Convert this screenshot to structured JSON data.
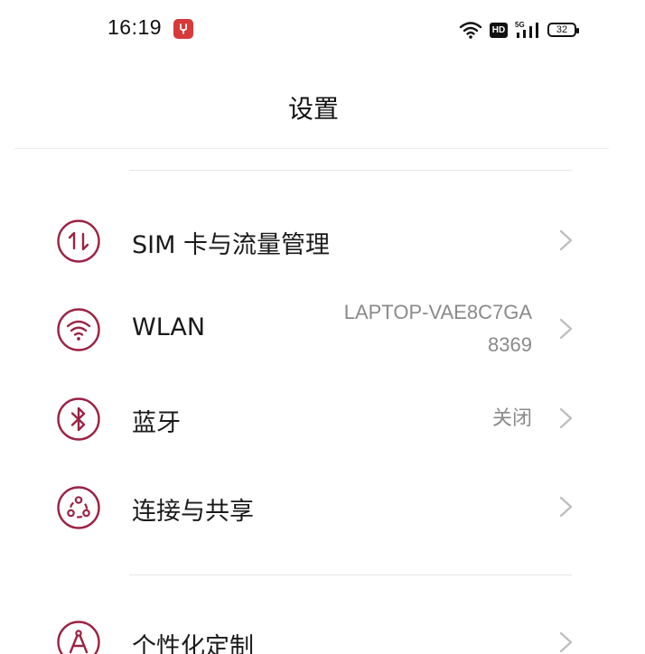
{
  "status_bar": {
    "time": "16:19",
    "hd_badge": "HD",
    "network_type": "5G",
    "battery_level": "32"
  },
  "header": {
    "title": "设置"
  },
  "settings": {
    "items": [
      {
        "label": "SIM 卡与流量管理",
        "icon": "sim-data-icon",
        "value": ""
      },
      {
        "label": "WLAN",
        "icon": "wifi-icon",
        "value_line1": "LAPTOP-VAE8C7GA",
        "value_line2": "8369"
      },
      {
        "label": "蓝牙",
        "icon": "bluetooth-icon",
        "value": "关闭"
      },
      {
        "label": "连接与共享",
        "icon": "connection-sharing-icon",
        "value": ""
      },
      {
        "label": "个性化定制",
        "icon": "personalization-icon",
        "value": ""
      }
    ]
  },
  "colors": {
    "accent": "#9b2345",
    "notification_badge": "#d63a3a",
    "secondary_text": "#8a8a8a",
    "chevron": "#bdbdbd"
  }
}
